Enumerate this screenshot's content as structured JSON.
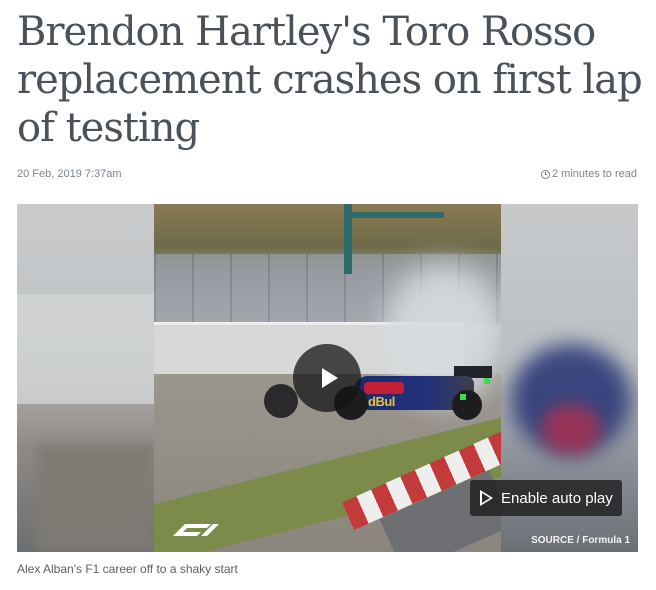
{
  "article": {
    "headline": "Brendon Hartley's Toro Rosso replacement crashes on first lap of testing",
    "date": "20 Feb, 2019 7:37am",
    "read_time": "2 minutes to read"
  },
  "video": {
    "play_label": "Play video",
    "autoplay_label": "Enable auto play",
    "source": "SOURCE / Formula 1",
    "car_logo_text": "dBul",
    "broadcaster_logo": "F1-logo"
  },
  "caption": "Alex Alban's F1 career off to a shaky start",
  "icons": {
    "clock": "clock-icon",
    "play": "play-icon",
    "autoplay": "play-outline-icon"
  },
  "colors": {
    "headline": "#4a5158",
    "meta": "#7d848a",
    "overlay": "#1e1e1e"
  }
}
